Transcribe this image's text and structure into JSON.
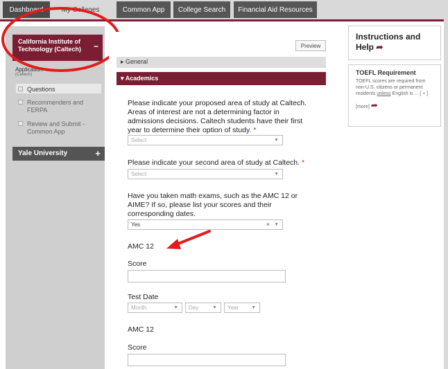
{
  "topnav": {
    "tabs": [
      {
        "label": "Dashboard"
      },
      {
        "label": "My Colleges"
      },
      {
        "label": "Common App"
      },
      {
        "label": "College Search"
      },
      {
        "label": "Financial Aid Resources"
      }
    ]
  },
  "sidebar": {
    "active_school": "California Institute of Technology (Caltech)",
    "collapse_symbol": "−",
    "application_label": "Application",
    "application_sub": "(Caltech)",
    "items": [
      {
        "label": "Questions"
      },
      {
        "label": "Recommenders and FERPA"
      },
      {
        "label": "Review and Submit - Common App"
      }
    ],
    "other_school": "Yale University",
    "expand_symbol": "+"
  },
  "main": {
    "preview_label": "Preview",
    "section_general": "General",
    "section_academics": "Academics",
    "q1": "Please indicate your proposed area of study at Caltech. Areas of interest are not a determining factor in admissions decisions. Caltech students have their first year to determine their option of study.",
    "q1_select_placeholder": "Select",
    "q2": "Please indicate your second area of study at Caltech.",
    "q2_select_placeholder": "Select",
    "q3": "Have you taken math exams, such as the AMC 12 or AIME? If so, please list your scores and their corresponding dates.",
    "q3_value": "Yes",
    "q3_clear": "×",
    "amc_label_1": "AMC 12",
    "score_label_1": "Score",
    "test_date_label": "Test Date",
    "month_placeholder": "Month",
    "day_placeholder": "Day",
    "year_placeholder": "Year",
    "amc_label_2": "AMC 12",
    "score_label_2": "Score",
    "required_mark": "*"
  },
  "help": {
    "title": "Instructions and Help",
    "toefl_title": "TOEFL Requirement",
    "toefl_body_1": "TOEFL scores are required from non-U.S. citizens or permanent residents ",
    "toefl_body_unless": "unless",
    "toefl_body_2": " English is ... [ + ]",
    "toefl_more": "[more]"
  },
  "colors": {
    "accent": "#7a1e34",
    "annotation": "#e21b1b"
  },
  "icons": [
    "chevron-down-icon",
    "clear-icon",
    "external-arrow-icon",
    "triangle-right-icon",
    "triangle-down-icon"
  ]
}
